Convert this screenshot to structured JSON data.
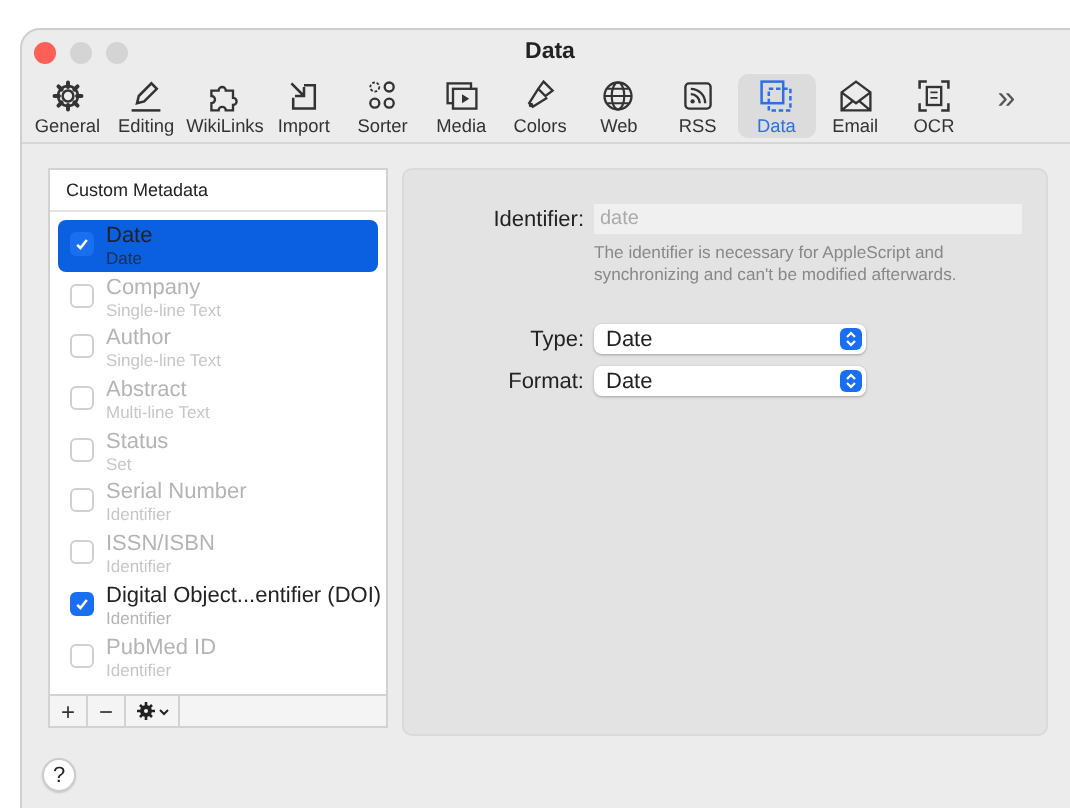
{
  "window": {
    "title": "Data"
  },
  "toolbar": {
    "items": [
      {
        "label": "General",
        "selected": false
      },
      {
        "label": "Editing",
        "selected": false
      },
      {
        "label": "WikiLinks",
        "selected": false
      },
      {
        "label": "Import",
        "selected": false
      },
      {
        "label": "Sorter",
        "selected": false
      },
      {
        "label": "Media",
        "selected": false
      },
      {
        "label": "Colors",
        "selected": false
      },
      {
        "label": "Web",
        "selected": false
      },
      {
        "label": "RSS",
        "selected": false
      },
      {
        "label": "Data",
        "selected": true
      },
      {
        "label": "Email",
        "selected": false
      },
      {
        "label": "OCR",
        "selected": false
      }
    ],
    "overflow": "»"
  },
  "metadata_list": {
    "header": "Custom Metadata",
    "items": [
      {
        "name": "Date",
        "type": "Date",
        "checked": true,
        "selected": true
      },
      {
        "name": "Company",
        "type": "Single-line Text",
        "checked": false,
        "selected": false
      },
      {
        "name": "Author",
        "type": "Single-line Text",
        "checked": false,
        "selected": false
      },
      {
        "name": "Abstract",
        "type": "Multi-line Text",
        "checked": false,
        "selected": false
      },
      {
        "name": "Status",
        "type": "Set",
        "checked": false,
        "selected": false
      },
      {
        "name": "Serial Number",
        "type": "Identifier",
        "checked": false,
        "selected": false
      },
      {
        "name": "ISSN/ISBN",
        "type": "Identifier",
        "checked": false,
        "selected": false
      },
      {
        "name": "Digital Object...entifier (DOI)",
        "type": "Identifier",
        "checked": true,
        "selected": false
      },
      {
        "name": "PubMed ID",
        "type": "Identifier",
        "checked": false,
        "selected": false
      }
    ],
    "buttons": [
      "+",
      "−"
    ]
  },
  "detail": {
    "identifier": {
      "label": "Identifier:",
      "value": "date",
      "disabled": true,
      "note": "The identifier is necessary for AppleScript and synchronizing and can't be modified afterwards."
    },
    "type": {
      "label": "Type:",
      "value": "Date"
    },
    "format": {
      "label": "Format:",
      "value": "Date"
    }
  },
  "help_button": "?"
}
